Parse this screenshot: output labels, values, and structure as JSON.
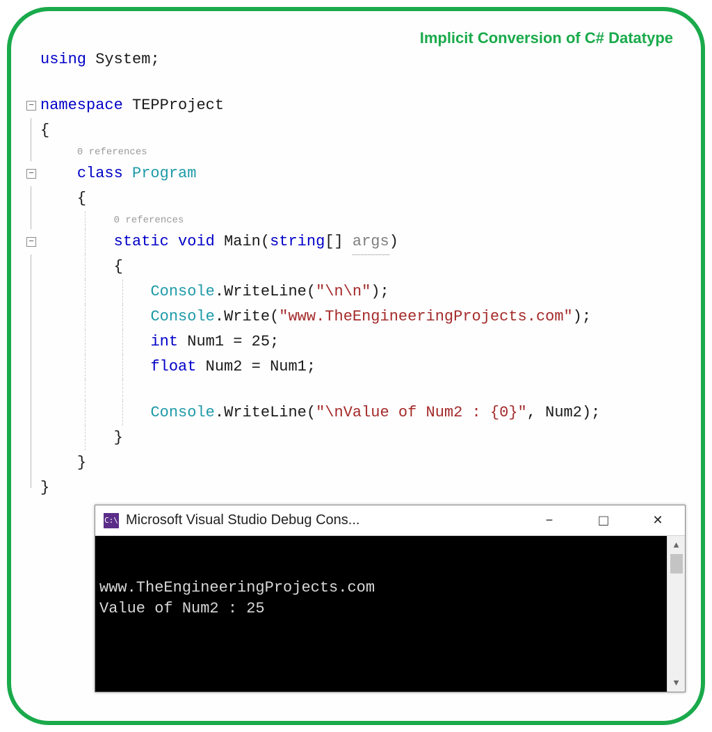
{
  "title": "Implicit Conversion of C# Datatype",
  "code": {
    "using_kw": "using",
    "system": "System",
    "semicolon": ";",
    "namespace_kw": "namespace",
    "namespace_name": "TEPProject",
    "open_brace": "{",
    "close_brace": "}",
    "refs0": "0 references",
    "class_kw": "class",
    "class_name": "Program",
    "refs1": "0 references",
    "static_kw": "static",
    "void_kw": "void",
    "main_name": "Main",
    "open_paren": "(",
    "string_kw": "string",
    "brackets": "[]",
    "args": "args",
    "close_paren": ")",
    "console_cls": "Console",
    "dot": ".",
    "writeline": "WriteLine",
    "write": "Write",
    "str_nn": "\"\\n\\n\"",
    "str_url": "\"www.TheEngineeringProjects.com\"",
    "int_kw": "int",
    "num1": "Num1",
    "eq": "=",
    "val25": "25",
    "float_kw": "float",
    "num2": "Num2",
    "str_val": "\"\\nValue of Num2 : {0}\"",
    "comma": ","
  },
  "console": {
    "icon_text": "C:\\",
    "title": "Microsoft Visual Studio Debug Cons...",
    "line1": "www.TheEngineeringProjects.com",
    "line2": "Value of Num2 : 25"
  },
  "glyphs": {
    "minus": "−",
    "square": "□",
    "close": "✕",
    "up": "▲",
    "down": "▼",
    "minusBox": "−"
  }
}
